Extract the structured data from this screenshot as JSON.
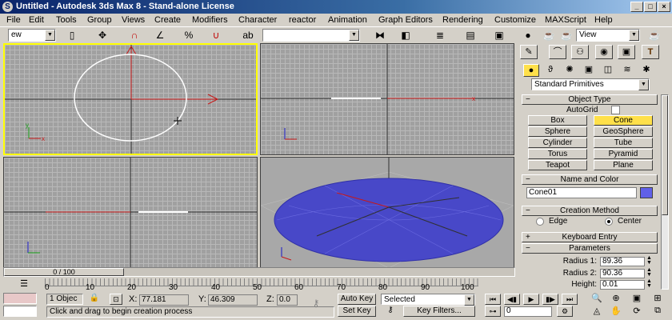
{
  "window": {
    "title": "Untitled - Autodesk 3ds Max 8 - Stand-alone License",
    "app_icon": "3ds-max-icon"
  },
  "menu": [
    "File",
    "Edit",
    "Tools",
    "Group",
    "Views",
    "Create",
    "Modifiers",
    "Character",
    "reactor",
    "Animation",
    "Graph Editors",
    "Rendering",
    "Customize",
    "MAXScript",
    "Help"
  ],
  "toolbar": {
    "selection_filter_value": "ew",
    "named_selection_value": "",
    "reference_coord_value": "View"
  },
  "command_panel": {
    "category_value": "Standard Primitives",
    "object_type": {
      "header": "Object Type",
      "autogrid_label": "AutoGrid",
      "buttons": [
        "Box",
        "Cone",
        "Sphere",
        "GeoSphere",
        "Cylinder",
        "Tube",
        "Torus",
        "Pyramid",
        "Teapot",
        "Plane"
      ],
      "selected": "Cone"
    },
    "name_color": {
      "header": "Name and Color",
      "name_value": "Cone01",
      "color": "#6060e8"
    },
    "creation_method": {
      "header": "Creation Method",
      "options": [
        "Edge",
        "Center"
      ],
      "selected": "Center"
    },
    "keyboard_entry": {
      "header": "Keyboard Entry"
    },
    "parameters": {
      "header": "Parameters",
      "radius1_label": "Radius 1:",
      "radius1_value": "89.36",
      "radius2_label": "Radius 2:",
      "radius2_value": "90.36",
      "height_label": "Height:",
      "height_value": "0.01"
    }
  },
  "timeline": {
    "slider_label": "0 / 100",
    "ticks": [
      "0",
      "10",
      "20",
      "30",
      "40",
      "50",
      "60",
      "70",
      "80",
      "90",
      "100"
    ]
  },
  "status": {
    "selection_count": "1 Objec",
    "x_label": "X:",
    "x_value": "77.181",
    "y_label": "Y:",
    "y_value": "46.309",
    "z_label": "Z:",
    "z_value": "0.0",
    "prompt": "Click and drag to begin creation process",
    "auto_key_label": "Auto Key",
    "set_key_label": "Set Key",
    "key_mode_value": "Selected",
    "key_filters_label": "Key Filters...",
    "frame_value": "0"
  },
  "colors": {
    "active_viewport_border": "#ffff00",
    "cone_fill": "#4848c8",
    "selected_button": "#ffe04a"
  }
}
